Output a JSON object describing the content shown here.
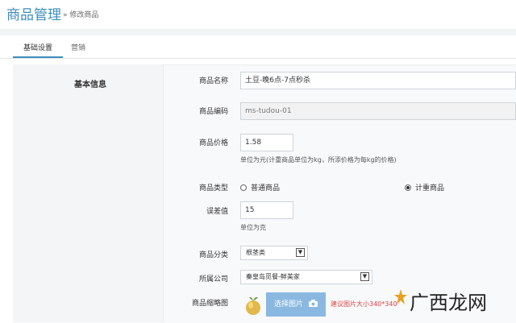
{
  "header": {
    "title": "商品管理",
    "breadcrumb": "» 修改商品"
  },
  "tabs": [
    {
      "label": "基础设置",
      "active": true
    },
    {
      "label": "营销",
      "active": false
    }
  ],
  "form": {
    "section_title": "基本信息",
    "name": {
      "label": "商品名称",
      "value": "土豆-晚6点-7点秒杀"
    },
    "code": {
      "label": "商品编码",
      "value": "ms-tudou-01"
    },
    "price": {
      "label": "商品价格",
      "value": "1.58",
      "hint": "单位为元(计重商品单位为kg，所添价格为每kg的价格)"
    },
    "type": {
      "label": "商品类型",
      "options": [
        "普通商品",
        "计重商品"
      ],
      "selected": "计重商品"
    },
    "error": {
      "label": "误差值",
      "value": "15",
      "hint": "单位为克"
    },
    "category": {
      "label": "商品分类",
      "value": "根茎类"
    },
    "company": {
      "label": "所属公司",
      "value": "秦皇岛觅餐-鲜美家"
    },
    "thumbnail": {
      "label": "商品缩略图",
      "button": "选择图片",
      "tip": "建议图片大小340*340"
    }
  },
  "watermark": {
    "text": "广西龙网"
  },
  "colors": {
    "accent": "#3c8dbc",
    "upload": "#8ab8e0",
    "tip": "#dd4444"
  }
}
